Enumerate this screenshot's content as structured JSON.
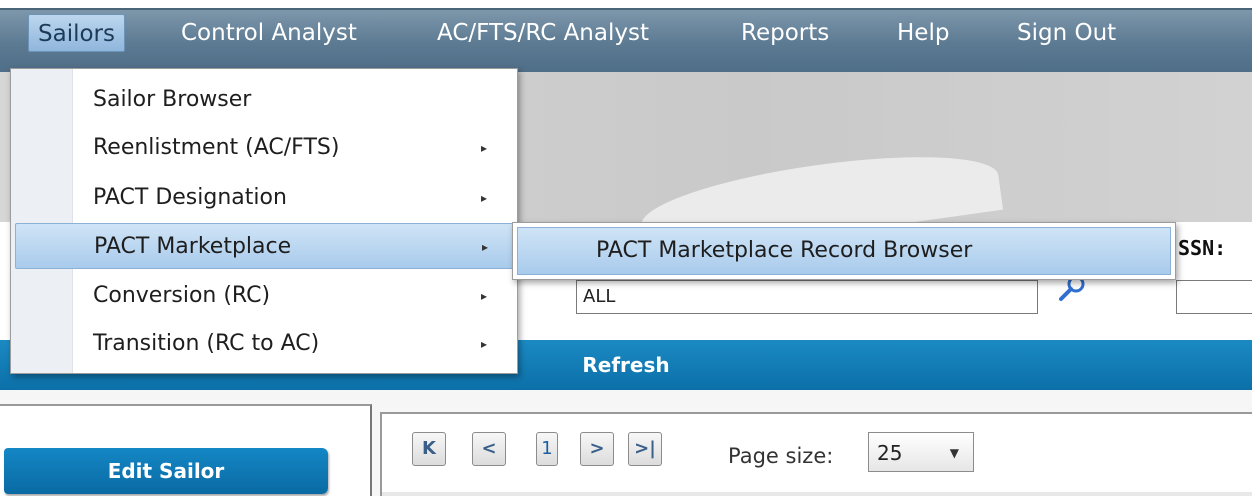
{
  "menubar": {
    "items": [
      {
        "label": "Sailors"
      },
      {
        "label": "Control Analyst"
      },
      {
        "label": "AC/FTS/RC Analyst"
      },
      {
        "label": "Reports"
      },
      {
        "label": "Help"
      },
      {
        "label": "Sign Out"
      }
    ]
  },
  "dropdown": {
    "items": [
      {
        "label": "Sailor Browser"
      },
      {
        "label": "Reenlistment (AC/FTS)"
      },
      {
        "label": "PACT Designation"
      },
      {
        "label": "PACT Marketplace"
      },
      {
        "label": "Conversion (RC)"
      },
      {
        "label": "Transition (RC to AC)"
      }
    ],
    "submenu_arrow": "▸"
  },
  "submenu": {
    "items": [
      {
        "label": "PACT Marketplace Record Browser"
      }
    ]
  },
  "filters": {
    "ssn_label": "SSN:",
    "all_value": "ALL"
  },
  "refresh": {
    "label": "Refresh"
  },
  "left_pane": {
    "edit_sailor_label": "Edit Sailor"
  },
  "pager": {
    "first": "K",
    "prev": "<",
    "page": "1",
    "next": ">",
    "last": ">|",
    "page_size_label": "Page size:",
    "page_size_value": "25",
    "caret": "▼"
  },
  "colors": {
    "menubar": "#5c7a92",
    "accent": "#0c6fa8",
    "highlight": "#a9cbec"
  }
}
